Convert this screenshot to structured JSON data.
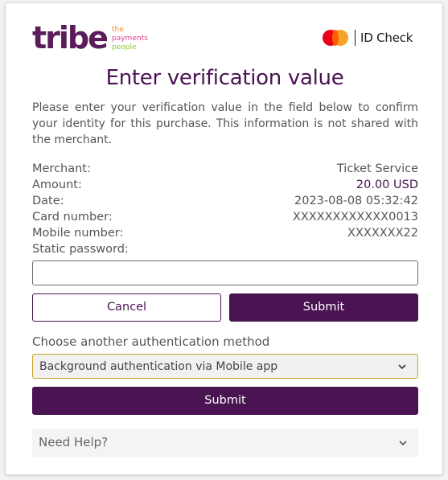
{
  "header": {
    "logo": {
      "word": "tribe",
      "tagline": [
        "the",
        "payments",
        "people"
      ],
      "word_color": "#5a1d5a",
      "tagline_colors": [
        "#f28c28",
        "#e83e8c",
        "#8dc63f"
      ]
    },
    "scheme_badge": {
      "icon": "mastercard-icon",
      "label": "ID Check"
    }
  },
  "title": "Enter verification value",
  "intro": "Please enter your verification value in the field below to confirm your identity for this purchase. This information is not shared with the merchant.",
  "details": [
    {
      "label": "Merchant:",
      "value": "Ticket Service"
    },
    {
      "label": "Amount:",
      "value": "20.00 USD"
    },
    {
      "label": "Date:",
      "value": "2023-08-08 05:32:42"
    },
    {
      "label": "Card number:",
      "value": "XXXXXXXXXXXX0013"
    },
    {
      "label": "Mobile number:",
      "value": "XXXXXXX22"
    },
    {
      "label": "Static password:",
      "value": ""
    }
  ],
  "password_field": {
    "value": "",
    "placeholder": ""
  },
  "actions": {
    "cancel_label": "Cancel",
    "submit_label": "Submit"
  },
  "alternative": {
    "label": "Choose another authentication method",
    "selected": "Background authentication via Mobile app",
    "submit_label": "Submit"
  },
  "help": {
    "label": "Need Help?"
  },
  "colors": {
    "primary": "#4a1352",
    "select_border": "#c9a227"
  }
}
